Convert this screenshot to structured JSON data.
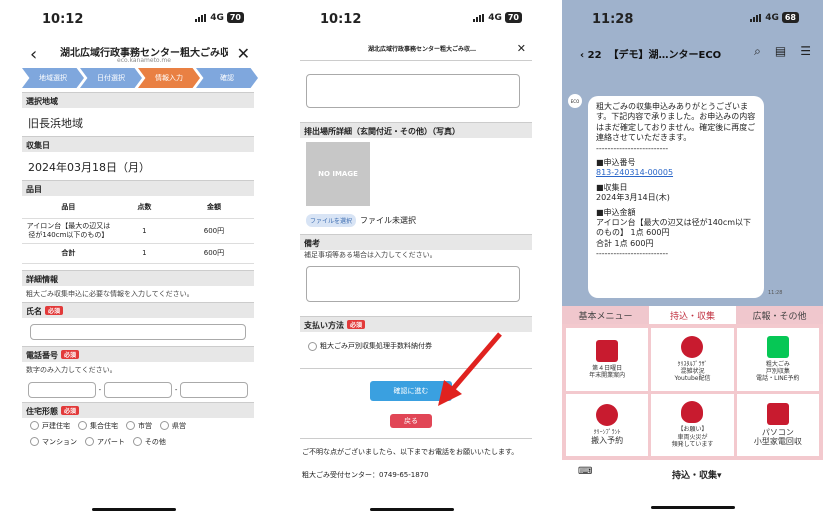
{
  "screen1": {
    "time": "10:12",
    "network": "4G",
    "battery": "70",
    "title": "湖北広域行政事務センター粗大ごみ収…",
    "domain": "eco.kanameto.me",
    "steps": [
      "地域選択",
      "日付選択",
      "情報入力",
      "確認"
    ],
    "area_label": "選択地域",
    "area_value": "旧長浜地域",
    "date_label": "収集日",
    "date_value": "2024年03月18日（月）",
    "items_label": "品目",
    "table_headers": [
      "品目",
      "点数",
      "金額"
    ],
    "row_item": "アイロン台【最大の辺又は径が140cm以下のもの】",
    "row_count": "1",
    "row_price": "600円",
    "total_label": "合計",
    "total_count": "1",
    "total_price": "600円",
    "detail_label": "詳細情報",
    "detail_desc": "粗大ごみ収集申込に必要な情報を入力してください。",
    "name_label": "氏名",
    "required": "必須",
    "phone_label": "電話番号",
    "phone_hint": "数字のみ入力してください。",
    "housing_label": "住宅形態",
    "housing_options": [
      "戸建住宅",
      "集合住宅",
      "市営",
      "県営",
      "マンション",
      "アパート",
      "その他"
    ]
  },
  "screen2": {
    "time": "10:12",
    "network": "4G",
    "battery": "70",
    "title": "湖北広域行政事務センター粗大ごみ収…",
    "location_label": "排出場所詳細（玄関付近・その他）（写真）",
    "no_image": "NO IMAGE",
    "file_button": "ファイルを選択",
    "file_status": "ファイル未選択",
    "notes_label": "備考",
    "notes_hint": "補足事項等ある場合は入力してください。",
    "payment_label": "支払い方法",
    "required": "必須",
    "payment_option": "粗大ごみ戸別収集処理手数料納付券",
    "confirm_button": "確認に進む",
    "back_button": "戻る",
    "footer_text": "ご不明な点がございましたら、以下までお電話をお願いいたします。",
    "footer_phone": "粗大ごみ受付センター：0749-65-1870"
  },
  "screen3": {
    "time": "11:28",
    "network": "4G",
    "battery": "68",
    "back_count": "22",
    "title": "【デモ】湖…ンターECO",
    "msg_intro": "粗大ごみの収集申込みありがとうございます。下記内容で承りました。お申込みの内容はまだ確定しておりません。確定後に再度ご連絡させていただきます。",
    "divider": "-------------------------",
    "app_no_label": "■申込番号",
    "app_no": "813-240314-00005",
    "collect_label": "■収集日",
    "collect_value": "2024年3月14日(木)",
    "amount_label": "■申込金額",
    "amount_value": "アイロン台【最大の辺又は径が140cm以下のもの】 1点 600円",
    "amount_total": "合計 1点 600円",
    "msg_time": "11:28",
    "menu_tabs": [
      "基本メニュー",
      "持込・収集",
      "広報・その他"
    ],
    "grid": [
      {
        "lines": [
          "第４日曜日",
          "年末開業案内"
        ]
      },
      {
        "lines": [
          "ｸﾘｽﾀﾙﾌﾟﾗｻﾞ",
          "混雑状況",
          "Youtube配信"
        ]
      },
      {
        "lines": [
          "粗大ごみ",
          "戸別収集",
          "電話・LINE予約"
        ]
      },
      {
        "lines": [
          "ｸﾘｰﾝﾌﾟﾗﾝﾄ",
          "搬入予約"
        ]
      },
      {
        "lines": [
          "【お願い】",
          "車両火災が",
          "頻発しています"
        ]
      },
      {
        "lines": [
          "パソコン",
          "小型家電回収"
        ]
      }
    ],
    "bottom_label": "持込・収集▾"
  }
}
